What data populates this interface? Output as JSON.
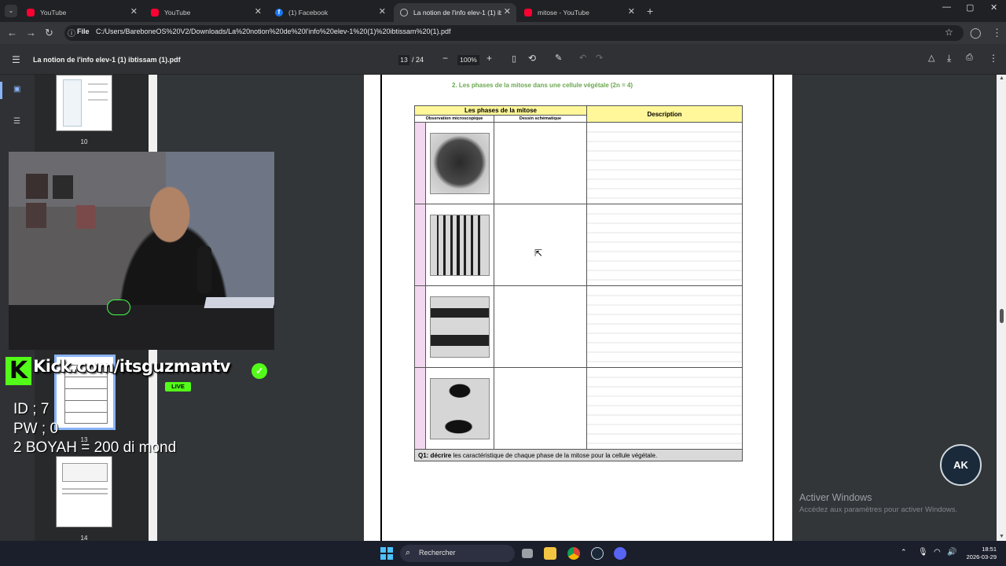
{
  "browser": {
    "tabs": [
      {
        "title": "YouTube",
        "icon": "youtube-icon",
        "active": false
      },
      {
        "title": "YouTube",
        "icon": "youtube-icon",
        "active": false
      },
      {
        "title": "(1) Facebook",
        "icon": "facebook-icon",
        "active": false
      },
      {
        "title": "La notion de l'info elev-1 (1) ib",
        "icon": "globe-icon",
        "active": true
      },
      {
        "title": "mitose - YouTube",
        "icon": "youtube-icon",
        "active": false
      }
    ],
    "new_tab": "+",
    "address": {
      "scheme_label": "File",
      "url": "C:/Users/BareboneOS%20V2/Downloads/La%20notion%20de%20l'info%20elev-1%20(1)%20ibtissam%20(1).pdf"
    }
  },
  "pdf_viewer": {
    "title": "La notion de l'info elev-1 (1) ibtissam (1).pdf",
    "current_page": "13",
    "total_pages": "/ 24",
    "zoom": "100%",
    "thumbnails": [
      {
        "page": "10"
      },
      {
        "page": "13"
      },
      {
        "page": "14"
      }
    ]
  },
  "document": {
    "heading": "2.    Les phases de la mitose dans une cellule végétale (2n = 4)",
    "table": {
      "header_phases": "Les phases de la mitose",
      "header_description": "Description",
      "sub_observation": "Observation microscopique",
      "sub_dessin": "Dessin schématique"
    },
    "q1_label": "Q1: décrire",
    "q1_text": " les caractéristique de chaque phase de la mitose pour la cellule végétale."
  },
  "stream_overlay": {
    "kick_letter": "K",
    "kick_url": "Kick.com/itsguzmantv",
    "live_badge": "LIVE",
    "id_line": "ID ; 7",
    "pw_line": "PW ; 0",
    "boyah_line": "2 BOYAH = 200 di  mond"
  },
  "watermark": {
    "line1": "Activer Windows",
    "line2": "Accédez aux paramètres pour activer Windows.",
    "logo_text": "AK"
  },
  "taskbar": {
    "search_placeholder": "Rechercher",
    "time": "18:51",
    "date": "2026-03-29"
  }
}
